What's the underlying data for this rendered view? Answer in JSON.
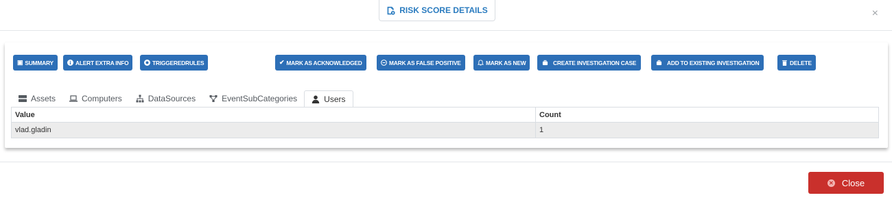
{
  "header": {
    "title": "RISK SCORE DETAILS",
    "close_icon": "×"
  },
  "actions": {
    "summary": "SUMMARY",
    "alert_extra_info": "ALERT EXTRA INFO",
    "triggered_rules": "TRIGGEREDRULES",
    "mark_acknowledged": "MARK AS ACKNOWLEDGED",
    "mark_false_positive": "MARK AS FALSE POSITIVE",
    "mark_new": "MARK AS NEW",
    "create_case": "CREATE INVESTIGATION CASE",
    "add_existing": "ADD TO EXISTING INVESTIGATION",
    "delete": "DELETE"
  },
  "tabs": [
    {
      "label": "Assets",
      "icon": "server-icon"
    },
    {
      "label": "Computers",
      "icon": "laptop-icon"
    },
    {
      "label": "DataSources",
      "icon": "sitemap-icon"
    },
    {
      "label": "EventSubCategories",
      "icon": "nodes-icon"
    },
    {
      "label": "Users",
      "icon": "user-icon",
      "active": true
    }
  ],
  "table": {
    "headers": [
      "Value",
      "Count"
    ],
    "rows": [
      [
        "vlad.gladin",
        "1"
      ]
    ]
  },
  "footer": {
    "close_label": "Close"
  },
  "colors": {
    "primary": "#2d6fb7",
    "danger": "#c9302c",
    "title": "#2a7bbf"
  }
}
